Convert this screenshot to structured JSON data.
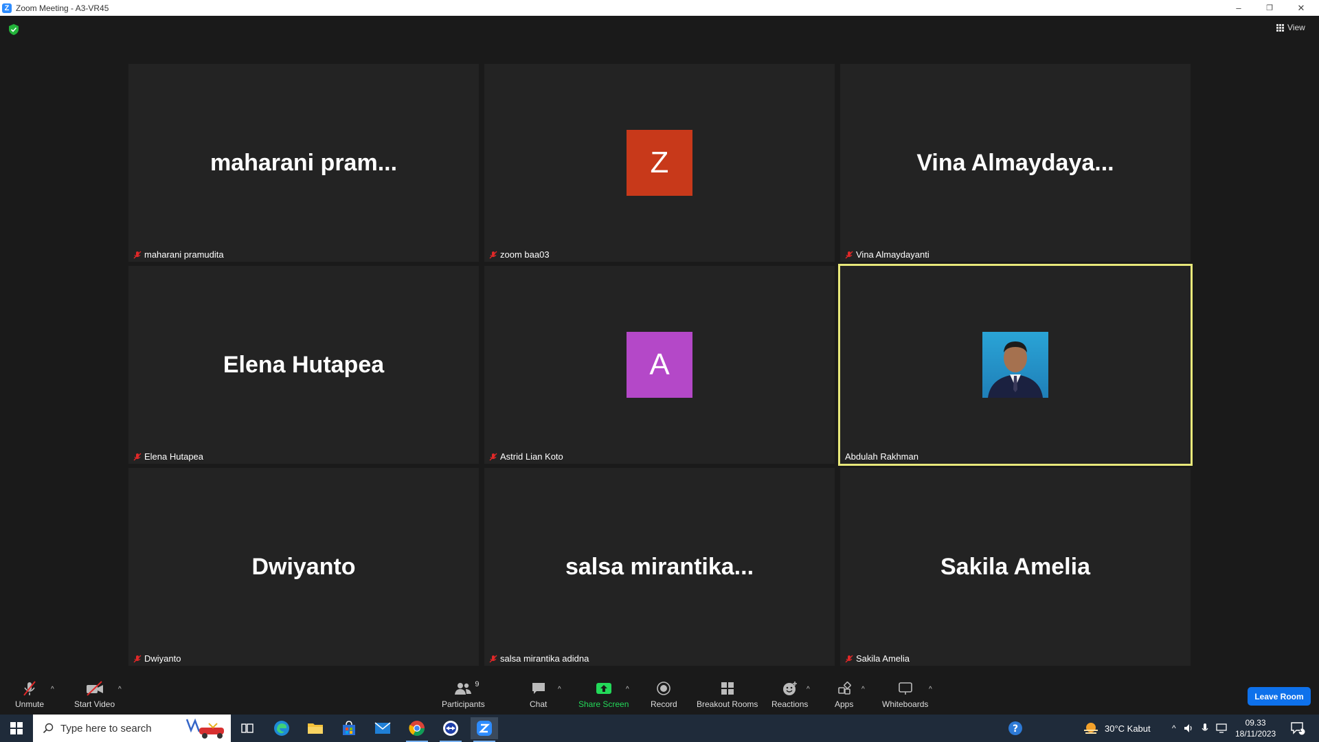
{
  "window": {
    "title": "Zoom Meeting - A3-VR45",
    "minimize": "–",
    "restore": "❐",
    "close": "✕"
  },
  "header": {
    "view_label": "View"
  },
  "tiles": [
    {
      "big": "maharani  pram...",
      "label": "maharani pramudita",
      "muted": true
    },
    {
      "avatar_letter": "Z",
      "avatar_color": "#c8391a",
      "label": "zoom baa03",
      "muted": true
    },
    {
      "big": "Vina  Almaydaya...",
      "label": "Vina Almaydayanti",
      "muted": true
    },
    {
      "big": "Elena Hutapea",
      "label": "Elena Hutapea",
      "muted": true
    },
    {
      "avatar_letter": "A",
      "avatar_color": "#b448c8",
      "label": "Astrid Lian Koto",
      "muted": true
    },
    {
      "photo": true,
      "label": "Abdulah Rakhman",
      "muted": false,
      "active": true
    },
    {
      "big": "Dwiyanto",
      "label": "Dwiyanto",
      "muted": true
    },
    {
      "big": "salsa  mirantika...",
      "label": "salsa mirantika adidna",
      "muted": true
    },
    {
      "big": "Sakila Amelia",
      "label": "Sakila Amelia",
      "muted": true
    }
  ],
  "toolbar": {
    "unmute": "Unmute",
    "start_video": "Start Video",
    "participants": "Participants",
    "participants_count": "9",
    "chat": "Chat",
    "share_screen": "Share Screen",
    "record": "Record",
    "breakout_rooms": "Breakout Rooms",
    "reactions": "Reactions",
    "apps": "Apps",
    "whiteboards": "Whiteboards",
    "leave": "Leave Room",
    "share_color": "#23d959",
    "leave_color": "#0e71eb"
  },
  "taskbar": {
    "search_placeholder": "Type here to search",
    "weather": "30°C  Kabut",
    "time": "09.33",
    "date": "18/11/2023",
    "notification_count": "1"
  }
}
